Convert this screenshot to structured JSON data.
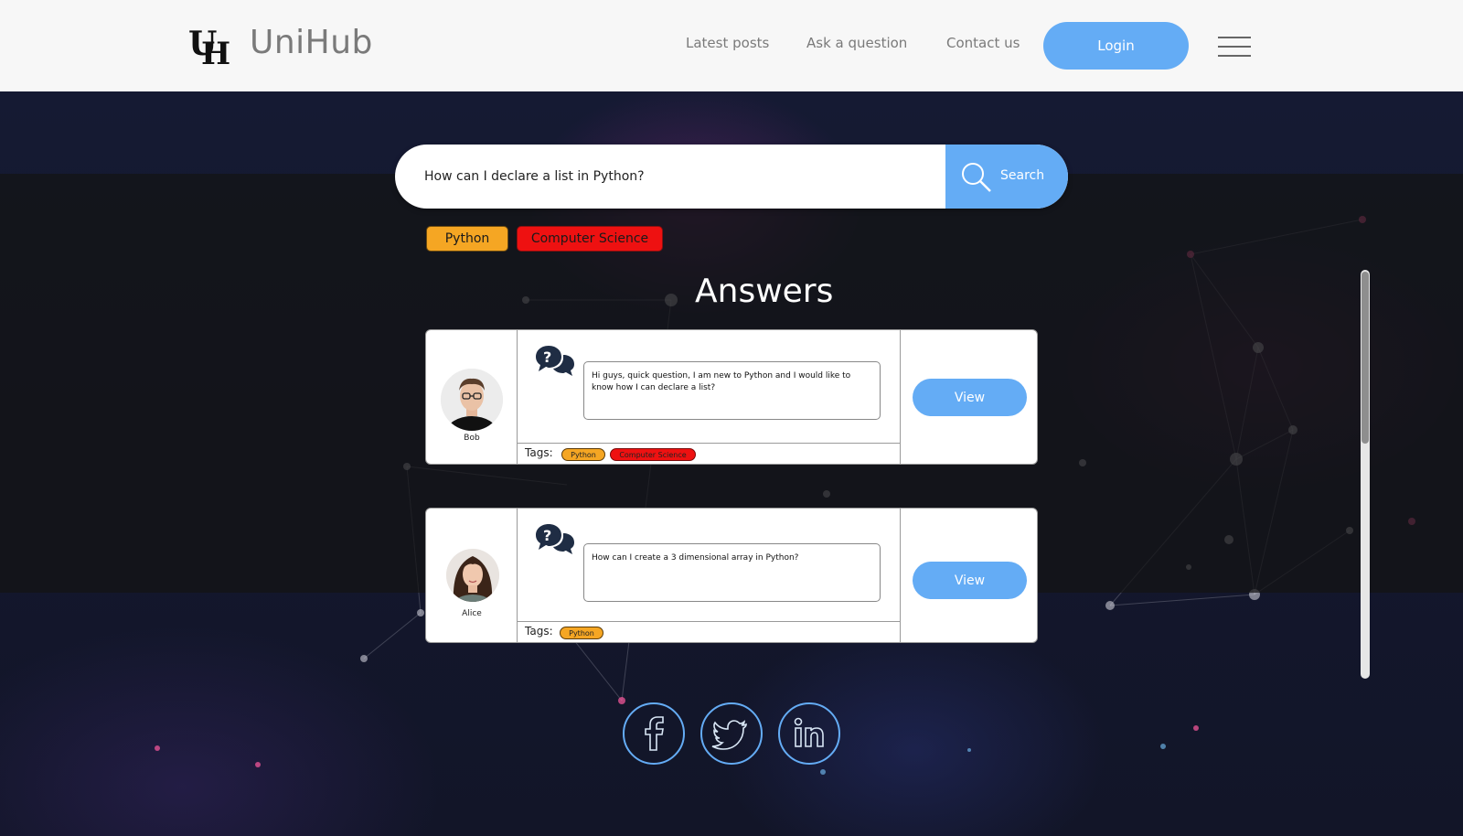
{
  "header": {
    "brand_name": "UniHub",
    "nav": [
      {
        "label": "Latest posts"
      },
      {
        "label": "Ask a question"
      },
      {
        "label": "Contact us"
      }
    ],
    "login_label": "Login"
  },
  "search": {
    "value": "How can I declare a list in Python?",
    "button_label": "Search"
  },
  "filter_tags": [
    {
      "label": "Python",
      "color": "#f5a623"
    },
    {
      "label": "Computer Science",
      "color": "#ee1111"
    }
  ],
  "answers_title": "Answers",
  "answers": [
    {
      "user": "Bob",
      "message": "Hi guys, quick question, I am new to Python and I would like to know how I can declare a list?",
      "tags_label": "Tags:",
      "tags": [
        "Python",
        "Computer Science"
      ],
      "view_label": "View"
    },
    {
      "user": "Alice",
      "message": "How can I create a 3 dimensional array in Python?",
      "tags_label": "Tags:",
      "tags": [
        "Python"
      ],
      "view_label": "View"
    }
  ],
  "social": [
    {
      "icon": "facebook-icon"
    },
    {
      "icon": "twitter-icon"
    },
    {
      "icon": "linkedin-icon"
    }
  ],
  "colors": {
    "accent": "#64acf5",
    "tag_python": "#f5a623",
    "tag_cs": "#ee1111"
  }
}
